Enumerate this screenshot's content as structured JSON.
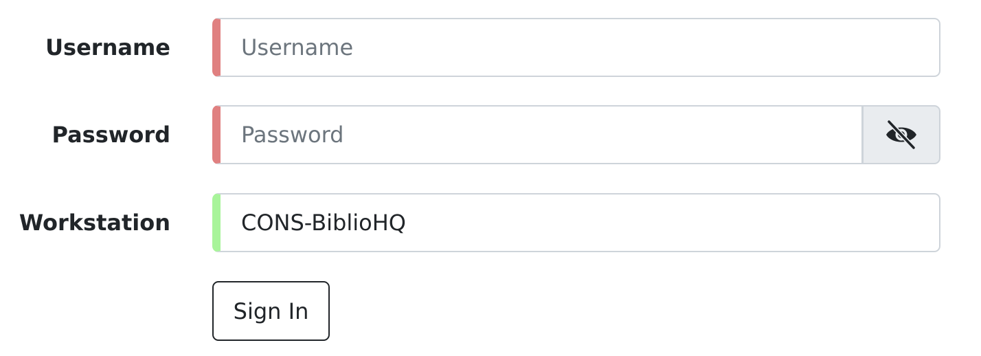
{
  "form": {
    "username": {
      "label": "Username",
      "placeholder": "Username",
      "value": ""
    },
    "password": {
      "label": "Password",
      "placeholder": "Password",
      "value": "",
      "toggle_icon": "eye-slash-icon"
    },
    "workstation": {
      "label": "Workstation",
      "value": "CONS-BiblioHQ"
    },
    "submit_label": "Sign In"
  },
  "colors": {
    "invalid_accent": "#e08080",
    "valid_accent": "#a8f49a",
    "border": "#ced4da",
    "addon_bg": "#e9ecef",
    "text": "#212529",
    "placeholder": "#6c757d"
  }
}
